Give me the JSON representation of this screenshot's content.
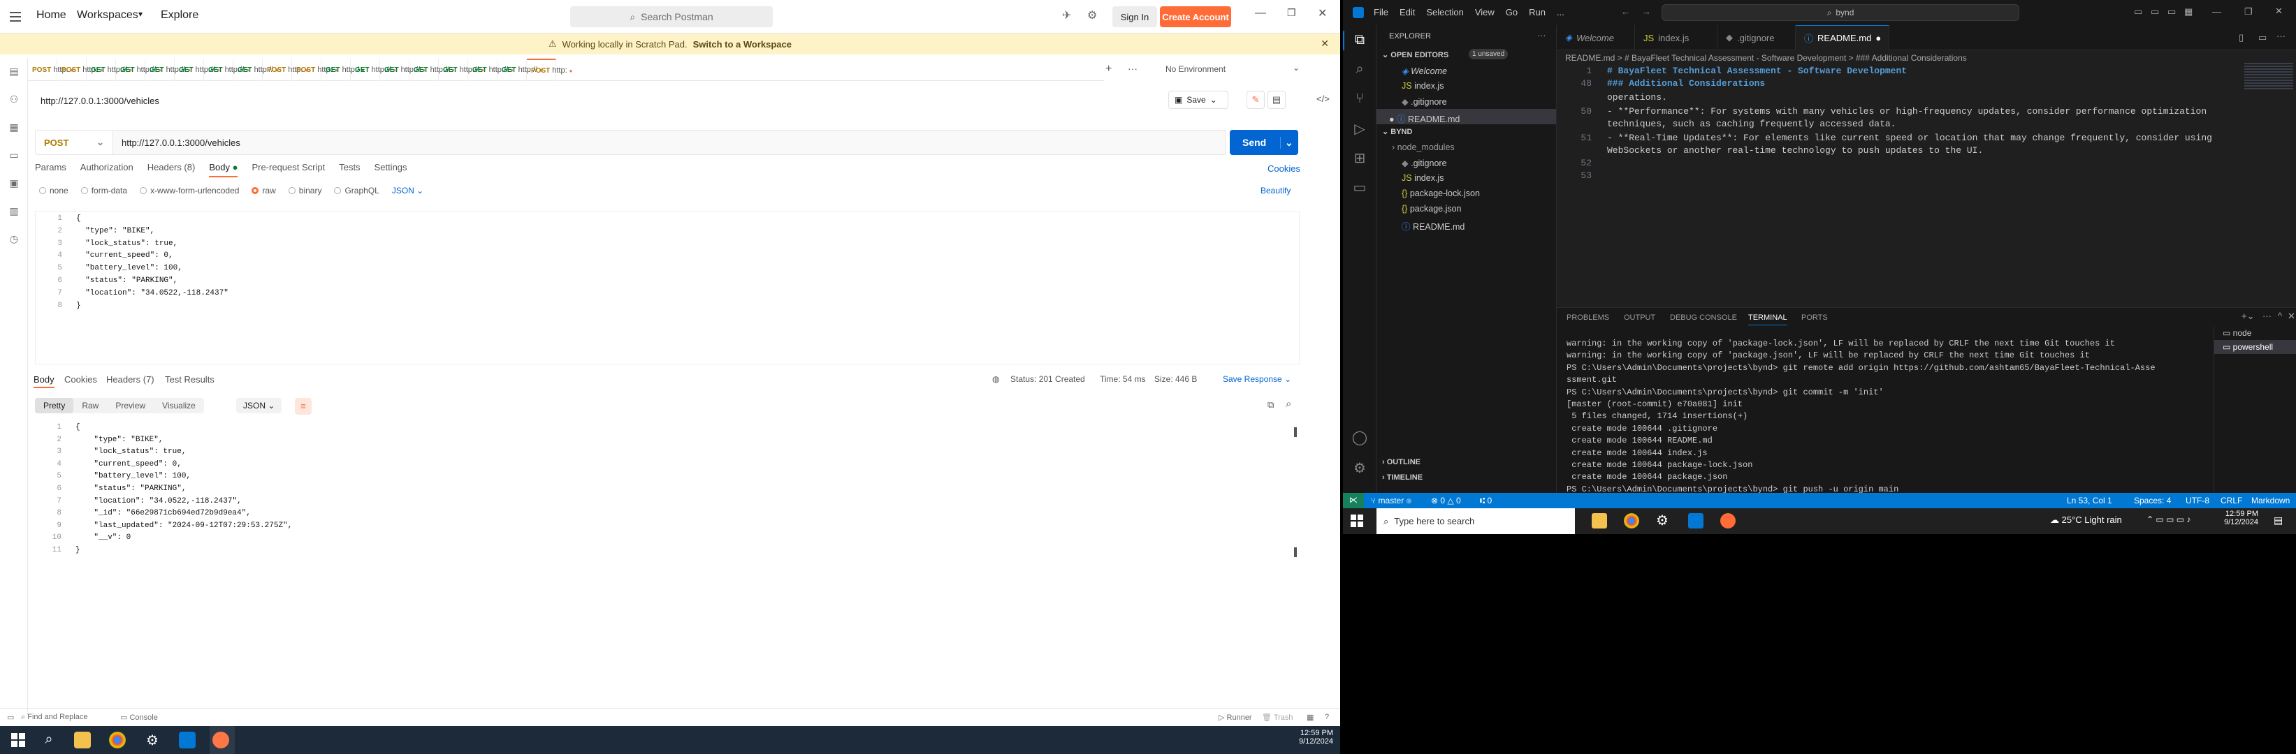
{
  "postman": {
    "nav": {
      "home": "Home",
      "workspaces": "Workspaces",
      "explore": "Explore"
    },
    "search_placeholder": "Search Postman",
    "sign_in": "Sign In",
    "create_account": "Create Account",
    "banner": {
      "text": "Working locally in Scratch Pad.",
      "link": "Switch to a Workspace"
    },
    "request_tabs": [
      {
        "method": "POST",
        "label": "http:"
      },
      {
        "method": "POST",
        "label": "http:"
      },
      {
        "method": "GET",
        "label": "http://"
      },
      {
        "method": "GET",
        "label": "http://"
      },
      {
        "method": "GET",
        "label": "http://"
      },
      {
        "method": "GET",
        "label": "http://"
      },
      {
        "method": "GET",
        "label": "http://"
      },
      {
        "method": "GET",
        "label": "http://"
      },
      {
        "method": "POST",
        "label": "http:"
      },
      {
        "method": "POST",
        "label": "http:"
      },
      {
        "method": "GET",
        "label": "http:/"
      },
      {
        "method": "GET",
        "label": "http://"
      },
      {
        "method": "GET",
        "label": "http://"
      },
      {
        "method": "GET",
        "label": "http://"
      },
      {
        "method": "GET",
        "label": "http://"
      },
      {
        "method": "GET",
        "label": "http://"
      },
      {
        "method": "GET",
        "label": "http://"
      },
      {
        "method": "POST",
        "label": "http:"
      }
    ],
    "environment": "No Environment",
    "request_title": "http://127.0.0.1:3000/vehicles",
    "save": "Save",
    "method": "POST",
    "url": "http://127.0.0.1:3000/vehicles",
    "send": "Send",
    "request_subtabs": [
      "Params",
      "Authorization",
      "Headers (8)",
      "Body",
      "Pre-request Script",
      "Tests",
      "Settings"
    ],
    "cookies": "Cookies",
    "body_types": [
      "none",
      "form-data",
      "x-www-form-urlencoded",
      "raw",
      "binary",
      "GraphQL"
    ],
    "body_lang": "JSON",
    "beautify": "Beautify",
    "request_body": [
      "{",
      "  \"type\": \"BIKE\",",
      "  \"lock_status\": true,",
      "  \"current_speed\": 0,",
      "  \"battery_level\": 100,",
      "  \"status\": \"PARKING\",",
      "  \"location\": \"34.0522,-118.2437\"",
      "}"
    ],
    "response_tabs": [
      "Body",
      "Cookies",
      "Headers (7)",
      "Test Results"
    ],
    "status": "Status: 201 Created",
    "time": "Time: 54 ms",
    "size": "Size: 446 B",
    "save_response": "Save Response",
    "view_modes": [
      "Pretty",
      "Raw",
      "Preview",
      "Visualize"
    ],
    "response_lang": "JSON",
    "response_body": [
      "{",
      "    \"type\": \"BIKE\",",
      "    \"lock_status\": true,",
      "    \"current_speed\": 0,",
      "    \"battery_level\": 100,",
      "    \"status\": \"PARKING\",",
      "    \"location\": \"34.0522,-118.2437\",",
      "    \"_id\": \"66e29871cb694ed72b9d9ea4\",",
      "    \"last_updated\": \"2024-09-12T07:29:53.275Z\",",
      "    \"__v\": 0",
      "}"
    ],
    "footer": {
      "find_replace": "Find and Replace",
      "console": "Console",
      "runner": "Runner",
      "trash": "Trash"
    },
    "taskbar": {
      "time": "12:59 PM",
      "date": "9/12/2024"
    }
  },
  "vscode": {
    "menu": [
      "File",
      "Edit",
      "Selection",
      "View",
      "Go",
      "Run",
      "..."
    ],
    "search": "bynd",
    "explorer_title": "EXPLORER",
    "open_editors": "OPEN EDITORS",
    "unsaved": "1 unsaved",
    "open_files": [
      "Welcome",
      "index.js",
      ".gitignore",
      "README.md"
    ],
    "folder": "BYND",
    "files": [
      "node_modules",
      ".gitignore",
      "index.js",
      "package-lock.json",
      "package.json",
      "README.md"
    ],
    "outline": "OUTLINE",
    "timeline": "TIMELINE",
    "tabs": [
      "Welcome",
      "index.js",
      ".gitignore",
      "README.md"
    ],
    "breadcrumb": "README.md > # BayaFleet Technical Assessment - Software Development > ### Additional Considerations",
    "code_lines": [
      {
        "n": "1",
        "t": "# BayaFleet Technical Assessment - Software Development"
      },
      {
        "n": "48",
        "t": "### Additional Considerations"
      },
      {
        "n": "",
        "t": "operations."
      },
      {
        "n": "50",
        "t": "- **Performance**: For systems with many vehicles or high-frequency updates, consider performance optimization"
      },
      {
        "n": "",
        "t": "techniques, such as caching frequently accessed data."
      },
      {
        "n": "51",
        "t": "- **Real-Time Updates**: For elements like current speed or location that may change frequently, consider using"
      },
      {
        "n": "",
        "t": "WebSockets or another real-time technology to push updates to the UI."
      },
      {
        "n": "52",
        "t": ""
      },
      {
        "n": "53",
        "t": ""
      }
    ],
    "panel_tabs": [
      "PROBLEMS",
      "OUTPUT",
      "DEBUG CONSOLE",
      "TERMINAL",
      "PORTS"
    ],
    "terminals": [
      "node",
      "powershell"
    ],
    "terminal_lines": [
      "warning: in the working copy of 'package-lock.json', LF will be replaced by CRLF the next time Git touches it",
      "warning: in the working copy of 'package.json', LF will be replaced by CRLF the next time Git touches it",
      "PS C:\\Users\\Admin\\Documents\\projects\\bynd> git remote add origin https://github.com/ashtam65/BayaFleet-Technical-Asse",
      "ssment.git",
      "PS C:\\Users\\Admin\\Documents\\projects\\bynd> git commit -m 'init'",
      "[master (root-commit) e70a081] init",
      " 5 files changed, 1714 insertions(+)",
      " create mode 100644 .gitignore",
      " create mode 100644 README.md",
      " create mode 100644 index.js",
      " create mode 100644 package-lock.json",
      " create mode 100644 package.json",
      "PS C:\\Users\\Admin\\Documents\\projects\\bynd> git push -u origin main"
    ],
    "status": {
      "branch": "master",
      "errors": "0",
      "warnings": "0",
      "ports": "0",
      "position": "Ln 53, Col 1",
      "spaces": "Spaces: 4",
      "encoding": "UTF-8",
      "eol": "CRLF",
      "lang": "Markdown"
    },
    "taskbar": {
      "search": "Type here to search",
      "weather": "25°C  Light rain",
      "time": "12:59 PM",
      "date": "9/12/2024"
    }
  },
  "colors": {
    "postman_orange": "#ff6c37",
    "send_blue": "#0265d2",
    "vscode_blue": "#0078d4"
  }
}
